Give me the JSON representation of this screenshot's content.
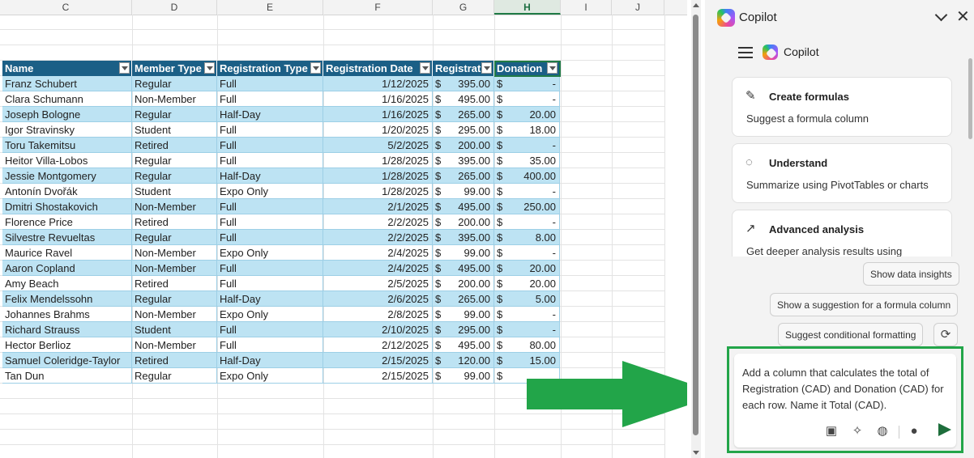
{
  "sheet": {
    "columns": [
      "C",
      "D",
      "E",
      "F",
      "G",
      "H",
      "I",
      "J"
    ],
    "selected_column": "H",
    "headers": [
      "Name",
      "Member Type",
      "Registration Type",
      "Registration Date",
      "Registrati",
      "Donation"
    ],
    "rows": [
      {
        "name": "Franz Schubert",
        "member": "Regular",
        "reg": "Full",
        "date": "1/12/2025",
        "fee": "395.00",
        "don": "-"
      },
      {
        "name": "Clara Schumann",
        "member": "Non-Member",
        "reg": "Full",
        "date": "1/16/2025",
        "fee": "495.00",
        "don": "-"
      },
      {
        "name": "Joseph Bologne",
        "member": "Regular",
        "reg": "Half-Day",
        "date": "1/16/2025",
        "fee": "265.00",
        "don": "20.00"
      },
      {
        "name": "Igor Stravinsky",
        "member": "Student",
        "reg": "Full",
        "date": "1/20/2025",
        "fee": "295.00",
        "don": "18.00"
      },
      {
        "name": "Toru Takemitsu",
        "member": "Retired",
        "reg": "Full",
        "date": "5/2/2025",
        "fee": "200.00",
        "don": "-"
      },
      {
        "name": "Heitor Villa-Lobos",
        "member": "Regular",
        "reg": "Full",
        "date": "1/28/2025",
        "fee": "395.00",
        "don": "35.00"
      },
      {
        "name": "Jessie Montgomery",
        "member": "Regular",
        "reg": "Half-Day",
        "date": "1/28/2025",
        "fee": "265.00",
        "don": "400.00"
      },
      {
        "name": "Antonín Dvořák",
        "member": "Student",
        "reg": "Expo Only",
        "date": "1/28/2025",
        "fee": "99.00",
        "don": "-"
      },
      {
        "name": "Dmitri Shostakovich",
        "member": "Non-Member",
        "reg": "Full",
        "date": "2/1/2025",
        "fee": "495.00",
        "don": "250.00"
      },
      {
        "name": "Florence Price",
        "member": "Retired",
        "reg": "Full",
        "date": "2/2/2025",
        "fee": "200.00",
        "don": "-"
      },
      {
        "name": "Silvestre Revueltas",
        "member": "Regular",
        "reg": "Full",
        "date": "2/2/2025",
        "fee": "395.00",
        "don": "8.00"
      },
      {
        "name": "Maurice Ravel",
        "member": "Non-Member",
        "reg": "Expo Only",
        "date": "2/4/2025",
        "fee": "99.00",
        "don": "-"
      },
      {
        "name": "Aaron Copland",
        "member": "Non-Member",
        "reg": "Full",
        "date": "2/4/2025",
        "fee": "495.00",
        "don": "20.00"
      },
      {
        "name": "Amy Beach",
        "member": "Retired",
        "reg": "Full",
        "date": "2/5/2025",
        "fee": "200.00",
        "don": "20.00"
      },
      {
        "name": "Felix Mendelssohn",
        "member": "Regular",
        "reg": "Half-Day",
        "date": "2/6/2025",
        "fee": "265.00",
        "don": "5.00"
      },
      {
        "name": "Johannes Brahms",
        "member": "Non-Member",
        "reg": "Expo Only",
        "date": "2/8/2025",
        "fee": "99.00",
        "don": "-"
      },
      {
        "name": "Richard Strauss",
        "member": "Student",
        "reg": "Full",
        "date": "2/10/2025",
        "fee": "295.00",
        "don": "-"
      },
      {
        "name": "Hector Berlioz",
        "member": "Non-Member",
        "reg": "Full",
        "date": "2/12/2025",
        "fee": "495.00",
        "don": "80.00"
      },
      {
        "name": "Samuel Coleridge-Taylor",
        "member": "Retired",
        "reg": "Half-Day",
        "date": "2/15/2025",
        "fee": "120.00",
        "don": "15.00"
      },
      {
        "name": "Tan Dun",
        "member": "Regular",
        "reg": "Expo Only",
        "date": "2/15/2025",
        "fee": "99.00",
        "don": ""
      }
    ],
    "currency_symbol": "$",
    "colors": {
      "header_bg": "#1b5f86",
      "band_bg": "#bde3f3",
      "selection": "#1f7a45"
    }
  },
  "copilot": {
    "title": "Copilot",
    "sub_title": "Copilot",
    "cards": [
      {
        "icon": "pen-icon",
        "title": "Create formulas",
        "desc": "Suggest a formula column"
      },
      {
        "icon": "lightbulb-icon",
        "title": "Understand",
        "desc": "Summarize using PivotTables or charts"
      },
      {
        "icon": "chart-line-icon",
        "title": "Advanced analysis",
        "desc": "Get deeper analysis results using"
      }
    ],
    "chips": [
      "Show data insights",
      "Show a suggestion for a formula column",
      "Suggest conditional formatting"
    ],
    "prompt": "Add a column that calculates the total of Registration (CAD) and Donation (CAD) for each row.  Name it Total (CAD).",
    "accent": "#22a549"
  }
}
